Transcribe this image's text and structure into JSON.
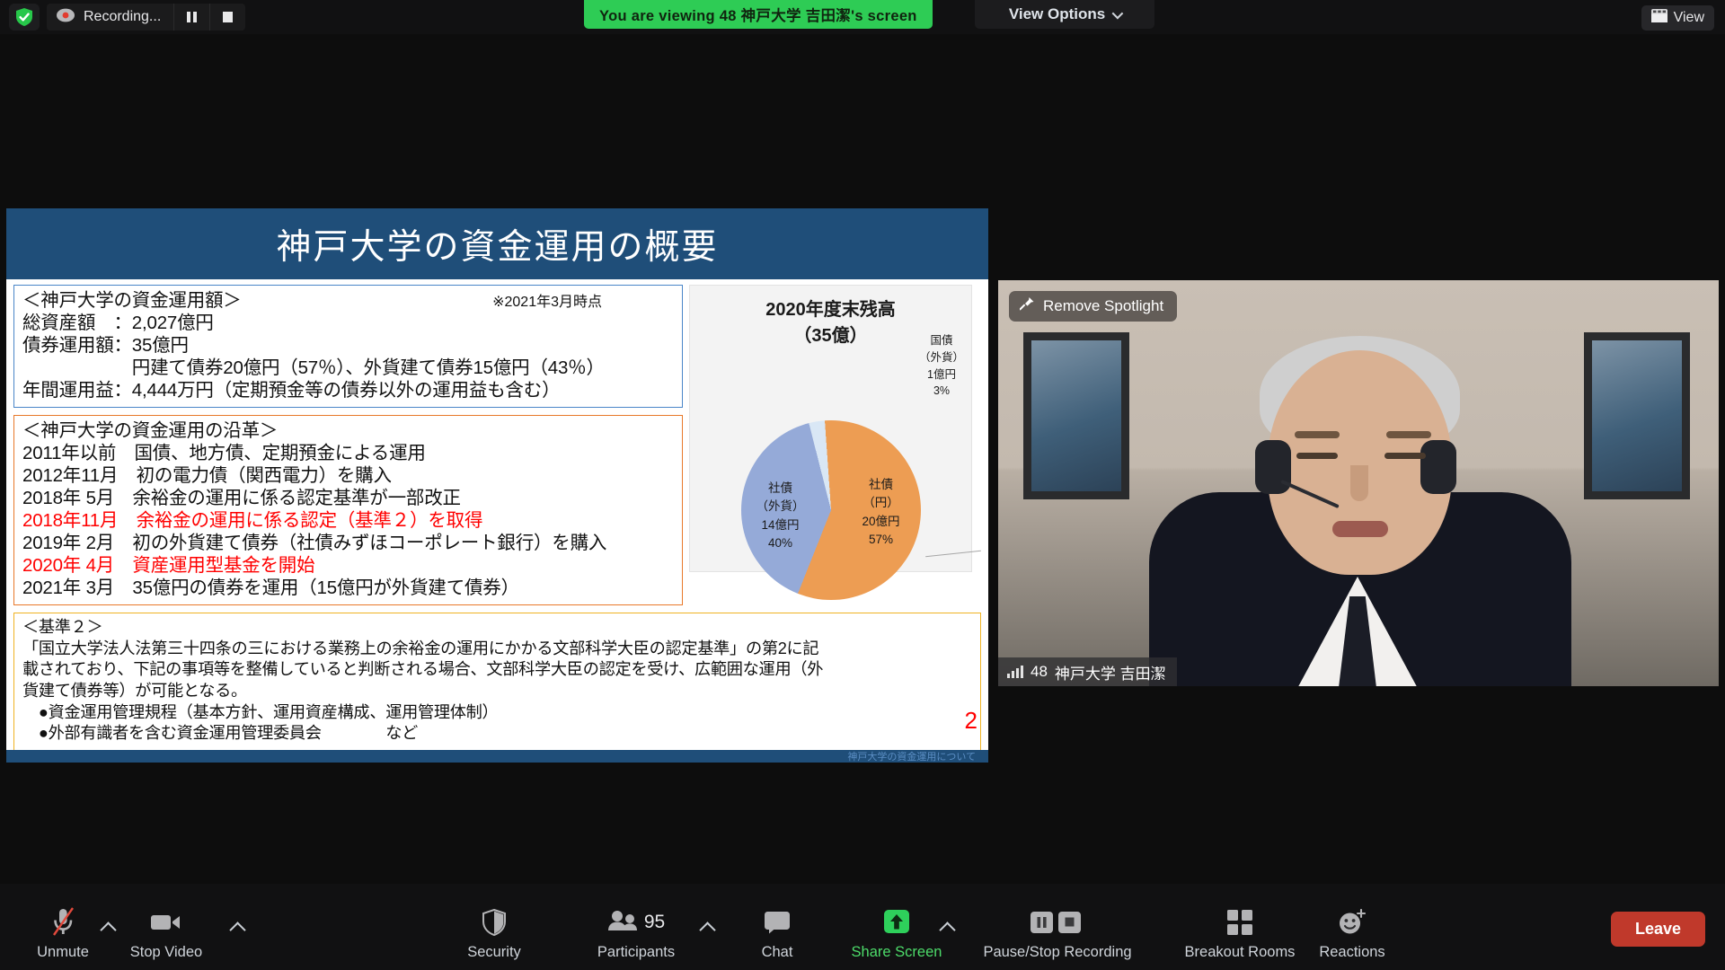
{
  "topbar": {
    "recording_label": "Recording...",
    "pause_icon": "pause-icon",
    "stop_icon": "stop-icon",
    "shield_icon": "shield-check-icon",
    "viewing_text": "You are viewing 48  神戸大学  吉田潔's screen",
    "view_options_label": "View Options",
    "view_label": "View"
  },
  "slide": {
    "title": "神戸大学の資金運用の概要",
    "box1": {
      "heading": "＜神戸大学の資金運用額＞",
      "note": "※2021年3月時点",
      "lines": [
        "総資産額　：2,027億円",
        "債券運用額：35億円",
        "　　　　　　円建て債券20億円（57％）、外貨建て債券15億円（43％）",
        "年間運用益：4,444万円（定期預金等の債券以外の運用益も含む）"
      ]
    },
    "box2": {
      "heading": "＜神戸大学の資金運用の沿革＞",
      "lines": [
        {
          "text": "2011年以前　国債、地方債、定期預金による運用",
          "red": false
        },
        {
          "text": "2012年11月　初の電力債（関西電力）を購入",
          "red": false
        },
        {
          "text": "2018年 5月　余裕金の運用に係る認定基準が一部改正",
          "red": false
        },
        {
          "text": "2018年11月　余裕金の運用に係る認定（基準２）を取得",
          "red": true
        },
        {
          "text": "2019年 2月　初の外貨建て債券（社債みずほコーポレート銀行）を購入",
          "red": false
        },
        {
          "text": "2020年 4月　資産運用型基金を開始",
          "red": true
        },
        {
          "text": "2021年 3月　35億円の債券を運用（15億円が外貨建て債券）",
          "red": false
        }
      ]
    },
    "box3": {
      "heading": "＜基準２＞",
      "lines": [
        "「国立大学法人法第三十四条の三における業務上の余裕金の運用にかかる文部科学大臣の認定基準」の第2に記",
        "載されており、下記の事項等を整備していると判断される場合、文部科学大臣の認定を受け、広範囲な運用（外",
        "貨建て債券等）が可能となる。",
        "　●資金運用管理規程（基本方針、運用資産構成、運用管理体制）",
        "　●外部有識者を含む資金運用管理委員会　　　　など"
      ]
    },
    "page_number": "2",
    "footer_text": "神戸大学の資金運用について"
  },
  "chart_data": {
    "type": "pie",
    "title": "2020年度末残高",
    "subtitle": "（35億）",
    "categories": [
      "社債（円）",
      "社債（外貨）",
      "国債（外貨）"
    ],
    "values": [
      20,
      14,
      1
    ],
    "unit": "億円",
    "percents": [
      57,
      40,
      3
    ],
    "colors": [
      "#ed9d53",
      "#95aad8",
      "#d9e7f5"
    ],
    "labels": [
      {
        "name": "社債",
        "sub": "（円）",
        "amount": "20億円",
        "pct": "57%"
      },
      {
        "name": "社債",
        "sub": "（外貨）",
        "amount": "14億円",
        "pct": "40%"
      },
      {
        "name": "国債",
        "sub": "（外貨）",
        "amount": "1億円",
        "pct": "3%"
      }
    ],
    "legend": "none",
    "grid": false
  },
  "video": {
    "spotlight_label": "Remove Spotlight",
    "pin_icon": "pin-icon",
    "signal_icon": "signal-bars-icon",
    "participant_id": "48",
    "participant_name": "神戸大学  吉田潔"
  },
  "toolbar": {
    "items": [
      {
        "name": "unmute",
        "label": "Unmute",
        "icon": "microphone-muted-icon",
        "caret": true,
        "green": false
      },
      {
        "name": "stop-video",
        "label": "Stop Video",
        "icon": "video-camera-icon",
        "caret": true,
        "green": false
      },
      {
        "name": "security",
        "label": "Security",
        "icon": "shield-icon",
        "caret": false,
        "green": false
      },
      {
        "name": "participants",
        "label": "Participants",
        "icon": "people-icon",
        "caret": true,
        "green": false,
        "badge": "95"
      },
      {
        "name": "chat",
        "label": "Chat",
        "icon": "chat-bubble-icon",
        "caret": false,
        "green": false
      },
      {
        "name": "share-screen",
        "label": "Share Screen",
        "icon": "share-arrow-up-icon",
        "caret": true,
        "green": true
      },
      {
        "name": "pause-stop-recording",
        "label": "Pause/Stop Recording",
        "icon": "pause-stop-icon",
        "caret": false,
        "green": false
      },
      {
        "name": "breakout-rooms",
        "label": "Breakout Rooms",
        "icon": "grid-squares-icon",
        "caret": false,
        "green": false
      },
      {
        "name": "reactions",
        "label": "Reactions",
        "icon": "smiley-plus-icon",
        "caret": false,
        "green": false
      }
    ],
    "leave_label": "Leave"
  }
}
